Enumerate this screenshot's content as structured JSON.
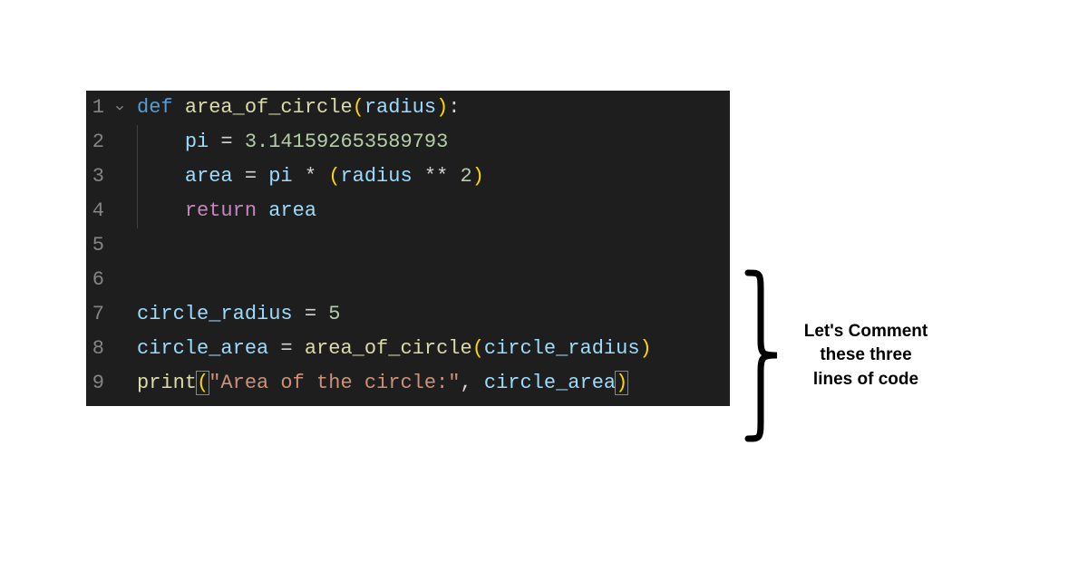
{
  "editor": {
    "lines": [
      {
        "num": "1"
      },
      {
        "num": "2"
      },
      {
        "num": "3"
      },
      {
        "num": "4"
      },
      {
        "num": "5"
      },
      {
        "num": "6"
      },
      {
        "num": "7"
      },
      {
        "num": "8"
      },
      {
        "num": "9"
      }
    ],
    "tokens": {
      "def": "def",
      "fn_name": "area_of_circle",
      "param": "radius",
      "pi_var": "pi",
      "pi_val": "3.141592653589793",
      "area_var": "area",
      "exp_val": "2",
      "return_kw": "return",
      "circle_radius": "circle_radius",
      "radius_val": "5",
      "circle_area": "circle_area",
      "print_fn": "print",
      "string_lit": "\"Area of the circle:\"",
      "equals": " = ",
      "star": " * ",
      "dstar": " ** ",
      "comma": ", ",
      "colon": ":",
      "lparen": "(",
      "rparen": ")"
    }
  },
  "annotation": {
    "line1": "Let's Comment",
    "line2": "these three",
    "line3": "lines of code"
  }
}
